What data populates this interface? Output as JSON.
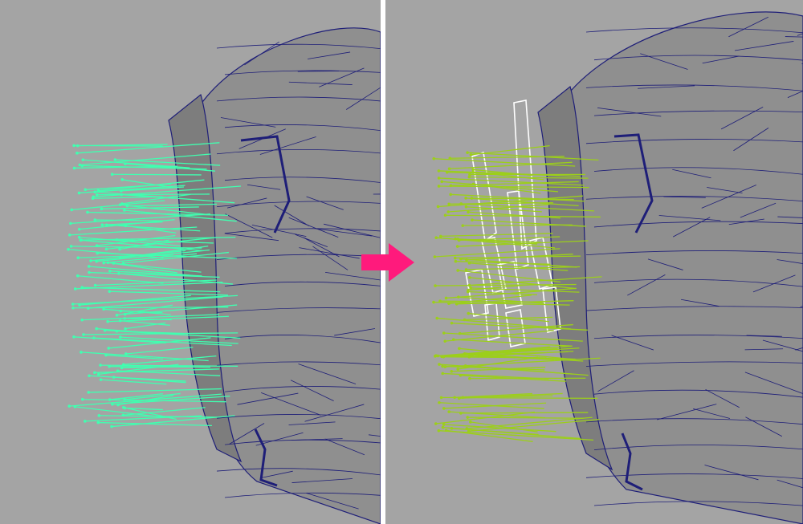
{
  "colors": {
    "viewport_bg": "#a4a4a4",
    "mesh_fill": "#8f8f8f",
    "wire": "#1e1e78",
    "vectors_before": "#40ffb0",
    "vectors_after": "#9ccf1a",
    "selection": "#ffffff",
    "arrow": "#ff1a7c",
    "divider": "#ffffff"
  },
  "icons": {
    "transition": "arrow-right-icon"
  },
  "panels": [
    {
      "id": "before",
      "state": "vectors-emitted"
    },
    {
      "id": "after",
      "state": "vectors-with-proxy-geometry"
    }
  ]
}
